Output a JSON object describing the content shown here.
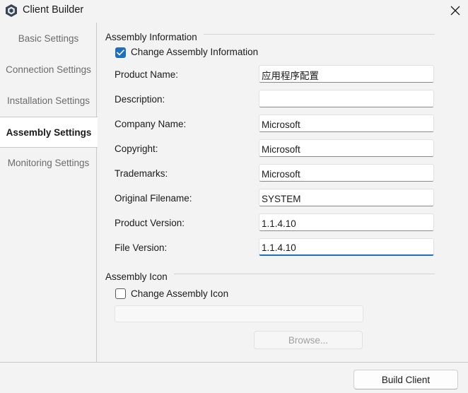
{
  "window": {
    "title": "Client Builder"
  },
  "sidebar": {
    "items": [
      {
        "label": "Basic Settings",
        "active": false
      },
      {
        "label": "Connection Settings",
        "active": false
      },
      {
        "label": "Installation Settings",
        "active": false
      },
      {
        "label": "Assembly Settings",
        "active": true
      },
      {
        "label": "Monitoring Settings",
        "active": false
      }
    ]
  },
  "assembly_info": {
    "group_title": "Assembly Information",
    "change_checkbox": {
      "label": "Change Assembly Information",
      "checked": true
    },
    "fields": [
      {
        "label": "Product Name:",
        "value": "应用程序配置"
      },
      {
        "label": "Description:",
        "value": ""
      },
      {
        "label": "Company Name:",
        "value": "Microsoft"
      },
      {
        "label": "Copyright:",
        "value": "Microsoft"
      },
      {
        "label": "Trademarks:",
        "value": "Microsoft"
      },
      {
        "label": "Original Filename:",
        "value": "SYSTEM"
      },
      {
        "label": "Product Version:",
        "value": "1.1.4.10"
      },
      {
        "label": "File Version:",
        "value": "1.1.4.10"
      }
    ]
  },
  "assembly_icon": {
    "group_title": "Assembly Icon",
    "change_checkbox": {
      "label": "Change Assembly Icon",
      "checked": false
    },
    "icon_path": "",
    "browse_label": "Browse..."
  },
  "footer": {
    "build_label": "Build Client"
  },
  "colors": {
    "accent": "#1f6fbf",
    "background": "#f3f3f3"
  }
}
